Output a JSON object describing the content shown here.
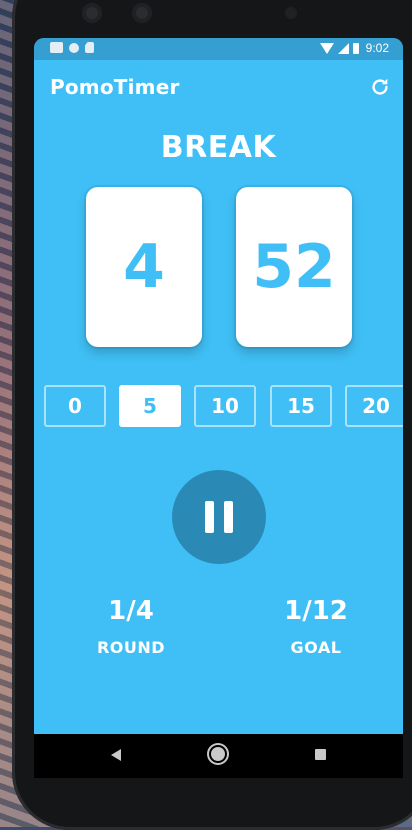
{
  "status_bar": {
    "time": "9:02"
  },
  "app_bar": {
    "title": "PomoTimer",
    "refresh_icon": "refresh-icon"
  },
  "timer": {
    "mode": "BREAK",
    "minutes": "4",
    "seconds": "52"
  },
  "durations": {
    "options": [
      "0",
      "5",
      "10",
      "15",
      "20"
    ],
    "selected": "5"
  },
  "controls": {
    "pause_icon": "pause-icon"
  },
  "stats": {
    "round": {
      "value": "1/4",
      "label": "ROUND"
    },
    "goal": {
      "value": "1/12",
      "label": "GOAL"
    }
  },
  "colors": {
    "background": "#3fbff5",
    "accent_button": "#2b8ab5",
    "card": "#ffffff"
  }
}
